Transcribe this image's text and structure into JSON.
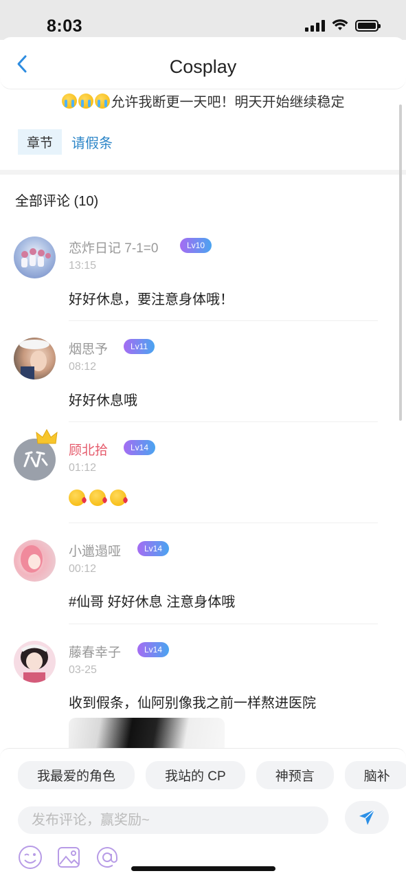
{
  "status": {
    "time": "8:03"
  },
  "nav": {
    "title": "Cosplay"
  },
  "notice": {
    "text": "允许我断更一天吧！明天开始继续稳定",
    "emoji_count": 3
  },
  "tags": {
    "chapter": "章节",
    "link": "请假条"
  },
  "comments_header": "全部评论 (10)",
  "comments": [
    {
      "name": "恋炸日记 7-1=0",
      "level": "Lv10",
      "time": "13:15",
      "text": "好好休息，要注意身体哦！",
      "avatar_color": "#8fa9d9"
    },
    {
      "name": "烟思予",
      "level": "Lv11",
      "time": "08:12",
      "text": "好好休息哦",
      "avatar_color": "#c7a38b"
    },
    {
      "name": "顾北拾",
      "level": "Lv14",
      "time": "01:12",
      "text": "",
      "emoji": "kiss",
      "emoji_count": 3,
      "avatar_color": "#9aa0aa",
      "crowned": true
    },
    {
      "name": "小邋遢哑",
      "level": "Lv14",
      "time": "00:12",
      "text": "#仙哥 好好休息 注意身体哦",
      "avatar_color": "#f0b8c0"
    },
    {
      "name": "藤春幸子",
      "level": "Lv14",
      "time": "03-25",
      "text": "收到假条，仙阿别像我之前一样熬进医院",
      "avatar_color": "#c98a9a"
    }
  ],
  "chips": [
    "我最爱的角色",
    "我站的 CP",
    "神预言",
    "脑补"
  ],
  "input": {
    "placeholder": "发布评论，赢奖励~"
  },
  "colors": {
    "accent": "#2d86c8",
    "level_start": "#a56cf2",
    "level_end": "#4aa4f0",
    "vip_name": "#e55a6b"
  },
  "icons": {
    "back": "chevron-left-icon",
    "send": "send-icon",
    "emoji": "smile-icon",
    "image": "image-icon",
    "mention": "at-icon"
  }
}
